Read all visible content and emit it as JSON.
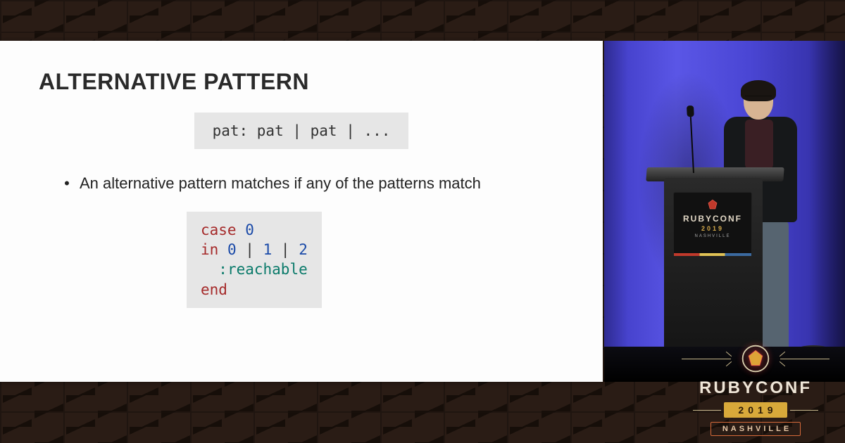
{
  "slide": {
    "title": "ALTERNATIVE PATTERN",
    "syntax": "pat: pat | pat | ...",
    "bullet": "An alternative pattern matches if any of the patterns match",
    "code": {
      "l1_kw": "case",
      "l1_val": "0",
      "l2_kw": "in",
      "l2_a": "0",
      "l2_b": "1",
      "l2_c": "2",
      "l3_sym": ":reachable",
      "l4_kw": "end"
    }
  },
  "podium": {
    "line1": "RUBYCONF",
    "line2": "2019",
    "line3": "NASHVILLE"
  },
  "logo": {
    "name": "RUBYCONF",
    "year": "2019",
    "city": "NASHVILLE"
  }
}
